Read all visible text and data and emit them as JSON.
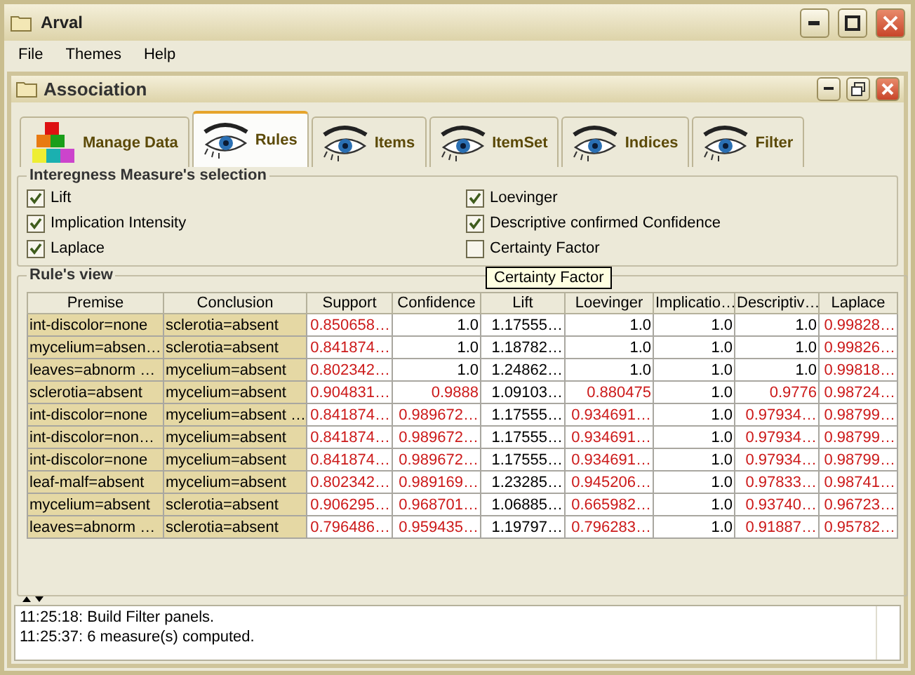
{
  "window": {
    "title": "Arval"
  },
  "menu": [
    "File",
    "Themes",
    "Help"
  ],
  "frame": {
    "title": "Association"
  },
  "tabs": [
    {
      "label": "Manage Data",
      "kind": "blocks",
      "selected": false
    },
    {
      "label": "Rules",
      "kind": "eye",
      "selected": true
    },
    {
      "label": "Items",
      "kind": "eye",
      "selected": false
    },
    {
      "label": "ItemSet",
      "kind": "eye",
      "selected": false
    },
    {
      "label": "Indices",
      "kind": "eye",
      "selected": false
    },
    {
      "label": "Filter",
      "kind": "eye",
      "selected": false
    }
  ],
  "measures": {
    "title": "Interegness Measure's selection",
    "items": [
      {
        "label": "Lift",
        "checked": true
      },
      {
        "label": "Loevinger",
        "checked": true
      },
      {
        "label": "Implication Intensity",
        "checked": true
      },
      {
        "label": "Descriptive confirmed Confidence",
        "checked": true
      },
      {
        "label": "Laplace",
        "checked": true
      },
      {
        "label": "Certainty Factor",
        "checked": false
      }
    ]
  },
  "tooltip": "Certainty Factor",
  "rules": {
    "title": "Rule's view",
    "columns": [
      "Premise",
      "Conclusion",
      "Support",
      "Confidence",
      "Lift",
      "Loevinger",
      "Implicatio…",
      "Descriptiv…",
      "Laplace"
    ],
    "rows": [
      {
        "cells": [
          {
            "kind": "label",
            "text": "int-discolor=none",
            "flagged": false
          },
          {
            "kind": "label",
            "text": "sclerotia=absent",
            "flagged": false
          },
          {
            "kind": "number",
            "text": "0.850658…",
            "flagged": true
          },
          {
            "kind": "number",
            "text": "1.0",
            "flagged": false
          },
          {
            "kind": "number",
            "text": "1.17555…",
            "flagged": false
          },
          {
            "kind": "number",
            "text": "1.0",
            "flagged": false
          },
          {
            "kind": "number",
            "text": "1.0",
            "flagged": false
          },
          {
            "kind": "number",
            "text": "1.0",
            "flagged": false
          },
          {
            "kind": "number",
            "text": "0.99828…",
            "flagged": true
          }
        ]
      },
      {
        "cells": [
          {
            "kind": "label",
            "text": "mycelium=absen…",
            "flagged": false
          },
          {
            "kind": "label",
            "text": "sclerotia=absent",
            "flagged": false
          },
          {
            "kind": "number",
            "text": "0.841874…",
            "flagged": true
          },
          {
            "kind": "number",
            "text": "1.0",
            "flagged": false
          },
          {
            "kind": "number",
            "text": "1.18782…",
            "flagged": false
          },
          {
            "kind": "number",
            "text": "1.0",
            "flagged": false
          },
          {
            "kind": "number",
            "text": "1.0",
            "flagged": false
          },
          {
            "kind": "number",
            "text": "1.0",
            "flagged": false
          },
          {
            "kind": "number",
            "text": "0.99826…",
            "flagged": true
          }
        ]
      },
      {
        "cells": [
          {
            "kind": "label",
            "text": "leaves=abnorm …",
            "flagged": false
          },
          {
            "kind": "label",
            "text": "mycelium=absent",
            "flagged": false
          },
          {
            "kind": "number",
            "text": "0.802342…",
            "flagged": true
          },
          {
            "kind": "number",
            "text": "1.0",
            "flagged": false
          },
          {
            "kind": "number",
            "text": "1.24862…",
            "flagged": false
          },
          {
            "kind": "number",
            "text": "1.0",
            "flagged": false
          },
          {
            "kind": "number",
            "text": "1.0",
            "flagged": false
          },
          {
            "kind": "number",
            "text": "1.0",
            "flagged": false
          },
          {
            "kind": "number",
            "text": "0.99818…",
            "flagged": true
          }
        ]
      },
      {
        "cells": [
          {
            "kind": "label",
            "text": "sclerotia=absent",
            "flagged": false
          },
          {
            "kind": "label",
            "text": "mycelium=absent",
            "flagged": false
          },
          {
            "kind": "number",
            "text": "0.904831…",
            "flagged": true
          },
          {
            "kind": "number",
            "text": "0.9888",
            "flagged": true
          },
          {
            "kind": "number",
            "text": "1.09103…",
            "flagged": false
          },
          {
            "kind": "number",
            "text": "0.880475",
            "flagged": true
          },
          {
            "kind": "number",
            "text": "1.0",
            "flagged": false
          },
          {
            "kind": "number",
            "text": "0.9776",
            "flagged": true
          },
          {
            "kind": "number",
            "text": "0.98724…",
            "flagged": true
          }
        ]
      },
      {
        "cells": [
          {
            "kind": "label",
            "text": "int-discolor=none",
            "flagged": false
          },
          {
            "kind": "label",
            "text": "mycelium=absent …",
            "flagged": false
          },
          {
            "kind": "number",
            "text": "0.841874…",
            "flagged": true
          },
          {
            "kind": "number",
            "text": "0.989672…",
            "flagged": true
          },
          {
            "kind": "number",
            "text": "1.17555…",
            "flagged": false
          },
          {
            "kind": "number",
            "text": "0.934691…",
            "flagged": true
          },
          {
            "kind": "number",
            "text": "1.0",
            "flagged": false
          },
          {
            "kind": "number",
            "text": "0.97934…",
            "flagged": true
          },
          {
            "kind": "number",
            "text": "0.98799…",
            "flagged": true
          }
        ]
      },
      {
        "cells": [
          {
            "kind": "label",
            "text": "int-discolor=non…",
            "flagged": false
          },
          {
            "kind": "label",
            "text": "mycelium=absent",
            "flagged": false
          },
          {
            "kind": "number",
            "text": "0.841874…",
            "flagged": true
          },
          {
            "kind": "number",
            "text": "0.989672…",
            "flagged": true
          },
          {
            "kind": "number",
            "text": "1.17555…",
            "flagged": false
          },
          {
            "kind": "number",
            "text": "0.934691…",
            "flagged": true
          },
          {
            "kind": "number",
            "text": "1.0",
            "flagged": false
          },
          {
            "kind": "number",
            "text": "0.97934…",
            "flagged": true
          },
          {
            "kind": "number",
            "text": "0.98799…",
            "flagged": true
          }
        ]
      },
      {
        "cells": [
          {
            "kind": "label",
            "text": "int-discolor=none",
            "flagged": false
          },
          {
            "kind": "label",
            "text": "mycelium=absent",
            "flagged": false
          },
          {
            "kind": "number",
            "text": "0.841874…",
            "flagged": true
          },
          {
            "kind": "number",
            "text": "0.989672…",
            "flagged": true
          },
          {
            "kind": "number",
            "text": "1.17555…",
            "flagged": false
          },
          {
            "kind": "number",
            "text": "0.934691…",
            "flagged": true
          },
          {
            "kind": "number",
            "text": "1.0",
            "flagged": false
          },
          {
            "kind": "number",
            "text": "0.97934…",
            "flagged": true
          },
          {
            "kind": "number",
            "text": "0.98799…",
            "flagged": true
          }
        ]
      },
      {
        "cells": [
          {
            "kind": "label",
            "text": "leaf-malf=absent",
            "flagged": false
          },
          {
            "kind": "label",
            "text": "mycelium=absent",
            "flagged": false
          },
          {
            "kind": "number",
            "text": "0.802342…",
            "flagged": true
          },
          {
            "kind": "number",
            "text": "0.989169…",
            "flagged": true
          },
          {
            "kind": "number",
            "text": "1.23285…",
            "flagged": false
          },
          {
            "kind": "number",
            "text": "0.945206…",
            "flagged": true
          },
          {
            "kind": "number",
            "text": "1.0",
            "flagged": false
          },
          {
            "kind": "number",
            "text": "0.97833…",
            "flagged": true
          },
          {
            "kind": "number",
            "text": "0.98741…",
            "flagged": true
          }
        ]
      },
      {
        "cells": [
          {
            "kind": "label",
            "text": "mycelium=absent",
            "flagged": false
          },
          {
            "kind": "label",
            "text": "sclerotia=absent",
            "flagged": false
          },
          {
            "kind": "number",
            "text": "0.906295…",
            "flagged": true
          },
          {
            "kind": "number",
            "text": "0.968701…",
            "flagged": true
          },
          {
            "kind": "number",
            "text": "1.06885…",
            "flagged": false
          },
          {
            "kind": "number",
            "text": "0.665982…",
            "flagged": true
          },
          {
            "kind": "number",
            "text": "1.0",
            "flagged": false
          },
          {
            "kind": "number",
            "text": "0.93740…",
            "flagged": true
          },
          {
            "kind": "number",
            "text": "0.96723…",
            "flagged": true
          }
        ]
      },
      {
        "cells": [
          {
            "kind": "label",
            "text": "leaves=abnorm …",
            "flagged": false
          },
          {
            "kind": "label",
            "text": "sclerotia=absent",
            "flagged": false
          },
          {
            "kind": "number",
            "text": "0.796486…",
            "flagged": true
          },
          {
            "kind": "number",
            "text": "0.959435…",
            "flagged": true
          },
          {
            "kind": "number",
            "text": "1.19797…",
            "flagged": false
          },
          {
            "kind": "number",
            "text": "0.796283…",
            "flagged": true
          },
          {
            "kind": "number",
            "text": "1.0",
            "flagged": false
          },
          {
            "kind": "number",
            "text": "0.91887…",
            "flagged": true
          },
          {
            "kind": "number",
            "text": "0.95782…",
            "flagged": true
          }
        ]
      }
    ]
  },
  "log": [
    "11:25:18: Build Filter panels.",
    "11:25:37: 6 measure(s) computed."
  ]
}
